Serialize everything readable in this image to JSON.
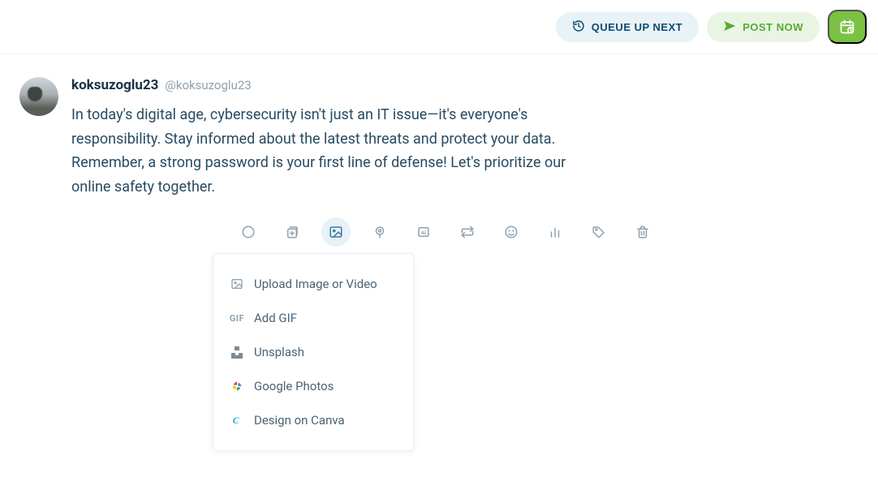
{
  "topbar": {
    "queue_label": "QUEUE UP NEXT",
    "post_label": "POST NOW"
  },
  "composer": {
    "display_name": "koksuzoglu23",
    "handle": "@koksuzoglu23",
    "text": "In today's digital age, cybersecurity isn't just an IT issue—it's everyone's responsibility. Stay informed about the latest threats and protect your data. Remember, a strong password is your first line of defense! Let's prioritize our online safety together."
  },
  "toolbar_icons": [
    "circle-icon",
    "add-collection-icon",
    "image-icon",
    "location-icon",
    "ai-icon",
    "retweet-icon",
    "emoji-icon",
    "poll-icon",
    "tag-icon",
    "trash-icon"
  ],
  "media_menu": {
    "upload": "Upload Image or Video",
    "gif": "Add GIF",
    "unsplash": "Unsplash",
    "gphotos": "Google Photos",
    "canva": "Design on Canva"
  }
}
